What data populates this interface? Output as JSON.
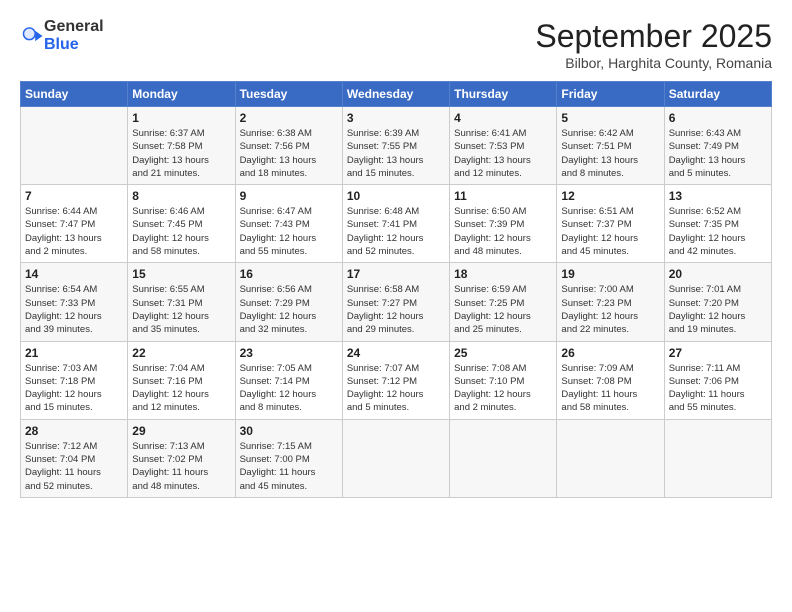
{
  "header": {
    "logo_general": "General",
    "logo_blue": "Blue",
    "month": "September 2025",
    "location": "Bilbor, Harghita County, Romania"
  },
  "days_of_week": [
    "Sunday",
    "Monday",
    "Tuesday",
    "Wednesday",
    "Thursday",
    "Friday",
    "Saturday"
  ],
  "weeks": [
    [
      {
        "day": "",
        "info": ""
      },
      {
        "day": "1",
        "info": "Sunrise: 6:37 AM\nSunset: 7:58 PM\nDaylight: 13 hours\nand 21 minutes."
      },
      {
        "day": "2",
        "info": "Sunrise: 6:38 AM\nSunset: 7:56 PM\nDaylight: 13 hours\nand 18 minutes."
      },
      {
        "day": "3",
        "info": "Sunrise: 6:39 AM\nSunset: 7:55 PM\nDaylight: 13 hours\nand 15 minutes."
      },
      {
        "day": "4",
        "info": "Sunrise: 6:41 AM\nSunset: 7:53 PM\nDaylight: 13 hours\nand 12 minutes."
      },
      {
        "day": "5",
        "info": "Sunrise: 6:42 AM\nSunset: 7:51 PM\nDaylight: 13 hours\nand 8 minutes."
      },
      {
        "day": "6",
        "info": "Sunrise: 6:43 AM\nSunset: 7:49 PM\nDaylight: 13 hours\nand 5 minutes."
      }
    ],
    [
      {
        "day": "7",
        "info": "Sunrise: 6:44 AM\nSunset: 7:47 PM\nDaylight: 13 hours\nand 2 minutes."
      },
      {
        "day": "8",
        "info": "Sunrise: 6:46 AM\nSunset: 7:45 PM\nDaylight: 12 hours\nand 58 minutes."
      },
      {
        "day": "9",
        "info": "Sunrise: 6:47 AM\nSunset: 7:43 PM\nDaylight: 12 hours\nand 55 minutes."
      },
      {
        "day": "10",
        "info": "Sunrise: 6:48 AM\nSunset: 7:41 PM\nDaylight: 12 hours\nand 52 minutes."
      },
      {
        "day": "11",
        "info": "Sunrise: 6:50 AM\nSunset: 7:39 PM\nDaylight: 12 hours\nand 48 minutes."
      },
      {
        "day": "12",
        "info": "Sunrise: 6:51 AM\nSunset: 7:37 PM\nDaylight: 12 hours\nand 45 minutes."
      },
      {
        "day": "13",
        "info": "Sunrise: 6:52 AM\nSunset: 7:35 PM\nDaylight: 12 hours\nand 42 minutes."
      }
    ],
    [
      {
        "day": "14",
        "info": "Sunrise: 6:54 AM\nSunset: 7:33 PM\nDaylight: 12 hours\nand 39 minutes."
      },
      {
        "day": "15",
        "info": "Sunrise: 6:55 AM\nSunset: 7:31 PM\nDaylight: 12 hours\nand 35 minutes."
      },
      {
        "day": "16",
        "info": "Sunrise: 6:56 AM\nSunset: 7:29 PM\nDaylight: 12 hours\nand 32 minutes."
      },
      {
        "day": "17",
        "info": "Sunrise: 6:58 AM\nSunset: 7:27 PM\nDaylight: 12 hours\nand 29 minutes."
      },
      {
        "day": "18",
        "info": "Sunrise: 6:59 AM\nSunset: 7:25 PM\nDaylight: 12 hours\nand 25 minutes."
      },
      {
        "day": "19",
        "info": "Sunrise: 7:00 AM\nSunset: 7:23 PM\nDaylight: 12 hours\nand 22 minutes."
      },
      {
        "day": "20",
        "info": "Sunrise: 7:01 AM\nSunset: 7:20 PM\nDaylight: 12 hours\nand 19 minutes."
      }
    ],
    [
      {
        "day": "21",
        "info": "Sunrise: 7:03 AM\nSunset: 7:18 PM\nDaylight: 12 hours\nand 15 minutes."
      },
      {
        "day": "22",
        "info": "Sunrise: 7:04 AM\nSunset: 7:16 PM\nDaylight: 12 hours\nand 12 minutes."
      },
      {
        "day": "23",
        "info": "Sunrise: 7:05 AM\nSunset: 7:14 PM\nDaylight: 12 hours\nand 8 minutes."
      },
      {
        "day": "24",
        "info": "Sunrise: 7:07 AM\nSunset: 7:12 PM\nDaylight: 12 hours\nand 5 minutes."
      },
      {
        "day": "25",
        "info": "Sunrise: 7:08 AM\nSunset: 7:10 PM\nDaylight: 12 hours\nand 2 minutes."
      },
      {
        "day": "26",
        "info": "Sunrise: 7:09 AM\nSunset: 7:08 PM\nDaylight: 11 hours\nand 58 minutes."
      },
      {
        "day": "27",
        "info": "Sunrise: 7:11 AM\nSunset: 7:06 PM\nDaylight: 11 hours\nand 55 minutes."
      }
    ],
    [
      {
        "day": "28",
        "info": "Sunrise: 7:12 AM\nSunset: 7:04 PM\nDaylight: 11 hours\nand 52 minutes."
      },
      {
        "day": "29",
        "info": "Sunrise: 7:13 AM\nSunset: 7:02 PM\nDaylight: 11 hours\nand 48 minutes."
      },
      {
        "day": "30",
        "info": "Sunrise: 7:15 AM\nSunset: 7:00 PM\nDaylight: 11 hours\nand 45 minutes."
      },
      {
        "day": "",
        "info": ""
      },
      {
        "day": "",
        "info": ""
      },
      {
        "day": "",
        "info": ""
      },
      {
        "day": "",
        "info": ""
      }
    ]
  ]
}
